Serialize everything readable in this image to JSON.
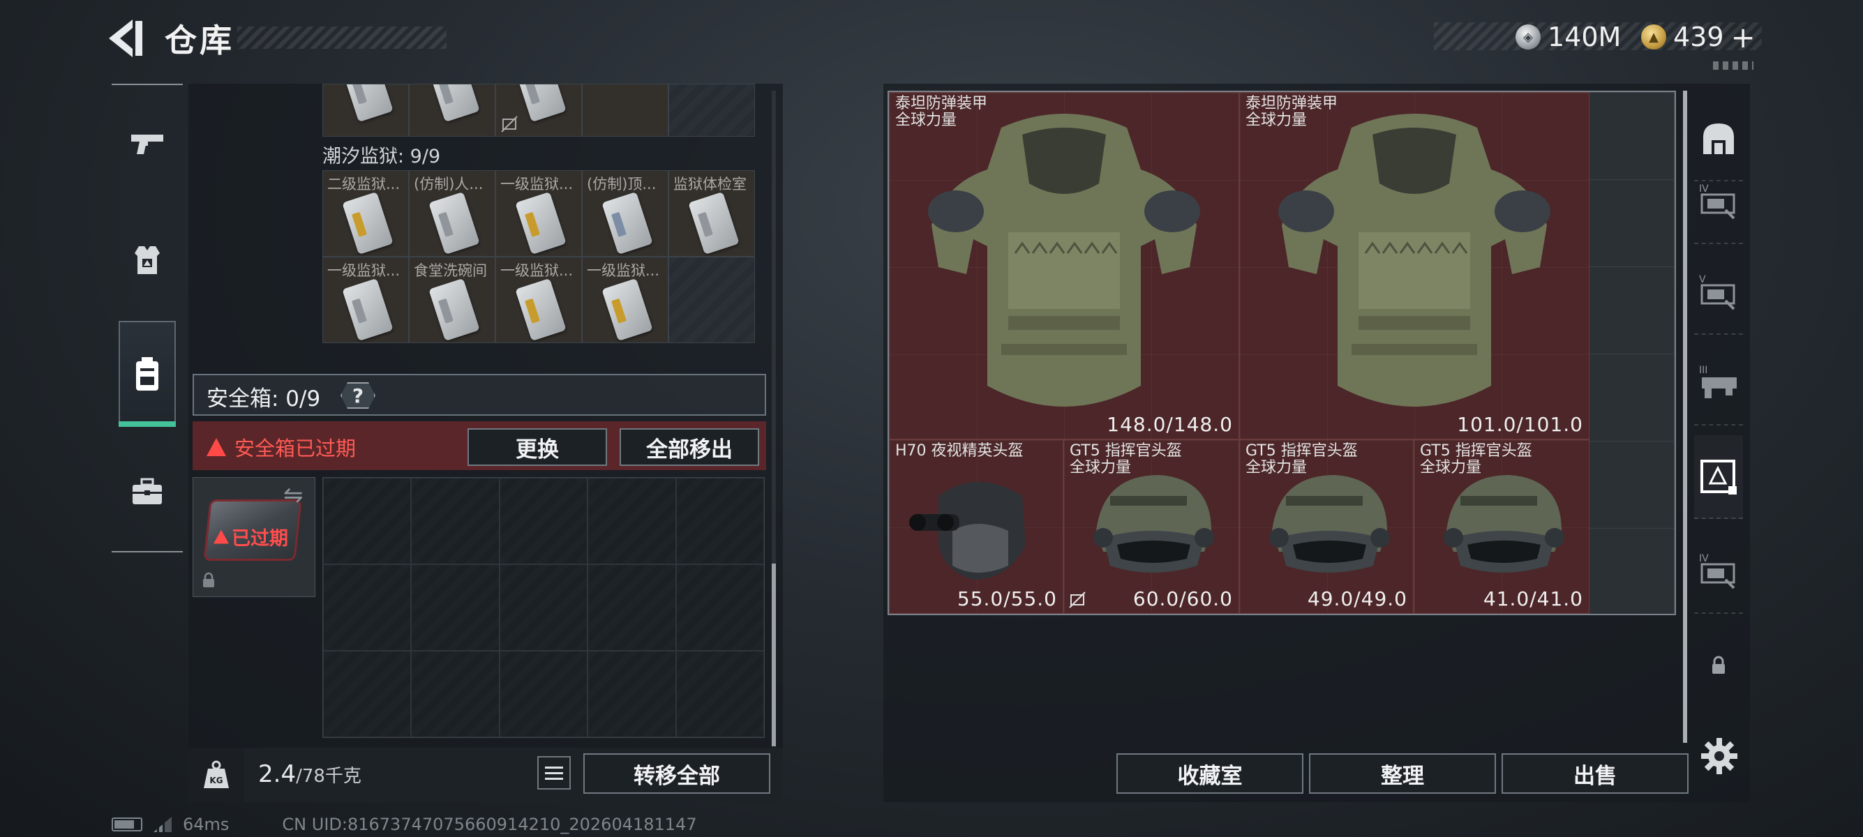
{
  "header": {
    "title": "仓库",
    "currencies": [
      {
        "icon": "silver-coin-icon",
        "value": "140M"
      },
      {
        "icon": "gold-coin-icon",
        "value": "439",
        "plus": "+"
      }
    ]
  },
  "left_nav": {
    "items": [
      {
        "name": "weapons",
        "icon": "pistol-icon"
      },
      {
        "name": "armor",
        "icon": "armor-vest-icon"
      },
      {
        "name": "backpack",
        "icon": "backpack-icon",
        "active": true
      },
      {
        "name": "supplies",
        "icon": "briefcase-icon"
      }
    ]
  },
  "storage": {
    "section_title": "潮汐监狱: 9/9",
    "items": [
      {
        "label": "二级监狱...",
        "card": "gold"
      },
      {
        "label": "(仿制)人...",
        "card": "silver"
      },
      {
        "label": "一级监狱...",
        "card": "gold"
      },
      {
        "label": "(仿制)顶...",
        "card": "blue"
      },
      {
        "label": "监狱体检室",
        "card": "silver"
      },
      {
        "label": "一级监狱...",
        "card": "silver"
      },
      {
        "label": "食堂洗碗间",
        "card": "silver"
      },
      {
        "label": "一级监狱...",
        "card": "gold"
      },
      {
        "label": "一级监狱...",
        "card": "gold"
      }
    ]
  },
  "safebox": {
    "title": "安全箱: 0/9",
    "help": "?",
    "expired_notice": "安全箱已过期",
    "replace_label": "更换",
    "remove_all_label": "全部移出",
    "slot_status": "已过期"
  },
  "weight": {
    "current": "2.4",
    "capacity": "/78千克",
    "icon_text": "KG",
    "transfer_all_label": "转移全部"
  },
  "status_bar": {
    "ping": "64ms",
    "uid": "CN UID:8167374707566091421​0_202604181147"
  },
  "equipment": [
    {
      "name": "泰坦防弹装甲",
      "sub": "全球力量",
      "durability": "148.0/148.0",
      "type": "armor"
    },
    {
      "name": "泰坦防弹装甲",
      "sub": "全球力量",
      "durability": "101.0/101.0",
      "type": "armor"
    },
    {
      "name": "H70 夜视精英头盔",
      "sub": "",
      "durability": "55.0/55.0",
      "type": "nvg-helmet"
    },
    {
      "name": "GT5 指挥官头盔",
      "sub": "全球力量",
      "durability": "60.0/60.0",
      "type": "helmet"
    },
    {
      "name": "GT5 指挥官头盔",
      "sub": "全球力量",
      "durability": "49.0/49.0",
      "type": "helmet"
    },
    {
      "name": "GT5 指挥官头盔",
      "sub": "全球力量",
      "durability": "41.0/41.0",
      "type": "helmet"
    }
  ],
  "right_actions": {
    "collection_label": "收藏室",
    "organize_label": "整理",
    "sell_label": "出售"
  },
  "right_tabs": [
    {
      "icon": "helmet-slot-icon",
      "roman": ""
    },
    {
      "icon": "tier-4-slot-icon",
      "roman": "IV"
    },
    {
      "icon": "tier-5-slot-icon",
      "roman": "V"
    },
    {
      "icon": "tier-3-slot-icon",
      "roman": "III"
    },
    {
      "icon": "selected-armor-slot-icon",
      "roman": ""
    },
    {
      "icon": "tier-4-slot-icon",
      "roman": "IV"
    },
    {
      "icon": "locked-slot-icon",
      "roman": ""
    }
  ]
}
